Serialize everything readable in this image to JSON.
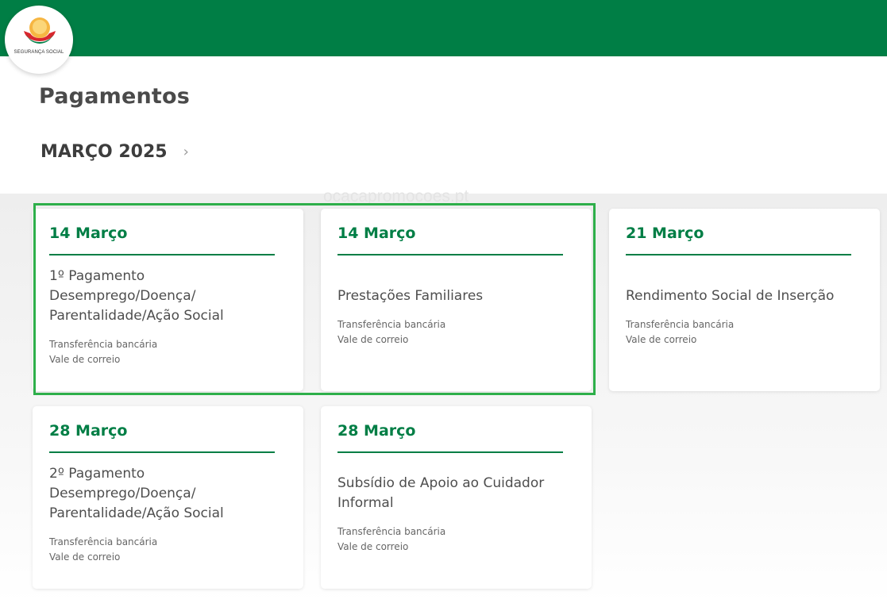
{
  "header": {
    "logo_text": "SEGURANÇA SOCIAL",
    "brand_color": "#007e45"
  },
  "page": {
    "title": "Pagamentos",
    "month": "MARÇO 2025",
    "next_icon": "chevron-right-icon"
  },
  "watermark": "ocacapromocoes.pt",
  "cards": [
    {
      "date": "14 Março",
      "title_lines": [
        "1º Pagamento",
        "Desemprego/Doença/",
        "Parentalidade/Ação Social"
      ],
      "methods": [
        "Transferência bancária",
        "Vale de correio"
      ]
    },
    {
      "date": "14 Março",
      "title_lines": [
        "Prestações Familiares"
      ],
      "methods": [
        "Transferência bancária",
        "Vale de correio"
      ]
    },
    {
      "date": "21 Março",
      "title_lines": [
        "Rendimento Social de Inserção"
      ],
      "methods": [
        "Transferência bancária",
        "Vale de correio"
      ]
    },
    {
      "date": "28 Março",
      "title_lines": [
        "2º Pagamento",
        "Desemprego/Doença/",
        "Parentalidade/Ação Social"
      ],
      "methods": [
        "Transferência bancária",
        "Vale de correio"
      ]
    },
    {
      "date": "28 Março",
      "title_lines": [
        "Subsídio de Apoio ao Cuidador",
        "Informal"
      ],
      "methods": [
        "Transferência bancária",
        "Vale de correio"
      ]
    }
  ],
  "highlight_color": "#2eaf4a"
}
